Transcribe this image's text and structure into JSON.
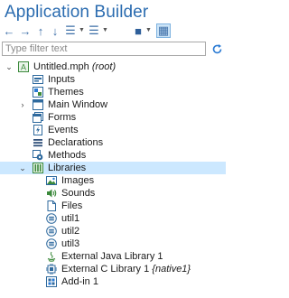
{
  "window": {
    "title": "Application Builder"
  },
  "toolbar": {
    "buttons": [
      {
        "icon": "arrow-left-icon",
        "glyph": "←"
      },
      {
        "icon": "arrow-right-icon",
        "glyph": "→"
      },
      {
        "icon": "arrow-up-icon",
        "glyph": "↑"
      },
      {
        "icon": "arrow-down-icon",
        "glyph": "↓"
      },
      {
        "icon": "collapse-list-icon",
        "glyph": "☰"
      },
      {
        "icon": "expand-list-icon",
        "glyph": "☰"
      },
      {
        "icon": "cube-icon",
        "glyph": "■"
      },
      {
        "icon": "model-tree-icon",
        "glyph": "▦"
      }
    ]
  },
  "filter": {
    "placeholder": "Type filter text",
    "value": ""
  },
  "tree": {
    "root": {
      "label": "Untitled.mph",
      "suffix": "(root)"
    },
    "items": [
      {
        "label": "Inputs",
        "icon": "inputs-icon"
      },
      {
        "label": "Themes",
        "icon": "themes-icon"
      },
      {
        "label": "Main Window",
        "icon": "main-window-icon"
      },
      {
        "label": "Forms",
        "icon": "forms-icon"
      },
      {
        "label": "Events",
        "icon": "events-icon"
      },
      {
        "label": "Declarations",
        "icon": "declarations-icon"
      },
      {
        "label": "Methods",
        "icon": "methods-icon"
      },
      {
        "label": "Libraries",
        "icon": "libraries-icon"
      }
    ],
    "libraries": [
      {
        "label": "Images",
        "icon": "images-icon"
      },
      {
        "label": "Sounds",
        "icon": "sounds-icon"
      },
      {
        "label": "Files",
        "icon": "files-icon"
      },
      {
        "label": "util1",
        "icon": "utility-icon"
      },
      {
        "label": "util2",
        "icon": "utility-icon"
      },
      {
        "label": "util3",
        "icon": "utility-icon"
      },
      {
        "label": "External Java Library 1",
        "icon": "java-icon"
      },
      {
        "label": "External C Library 1",
        "suffix": "{native1}",
        "icon": "c-library-icon"
      },
      {
        "label": "Add-in 1",
        "icon": "add-in-icon"
      }
    ]
  },
  "colors": {
    "accent": "#2b6cb0",
    "selection": "#cce8ff",
    "icon_blue": "#2b7bd4"
  }
}
